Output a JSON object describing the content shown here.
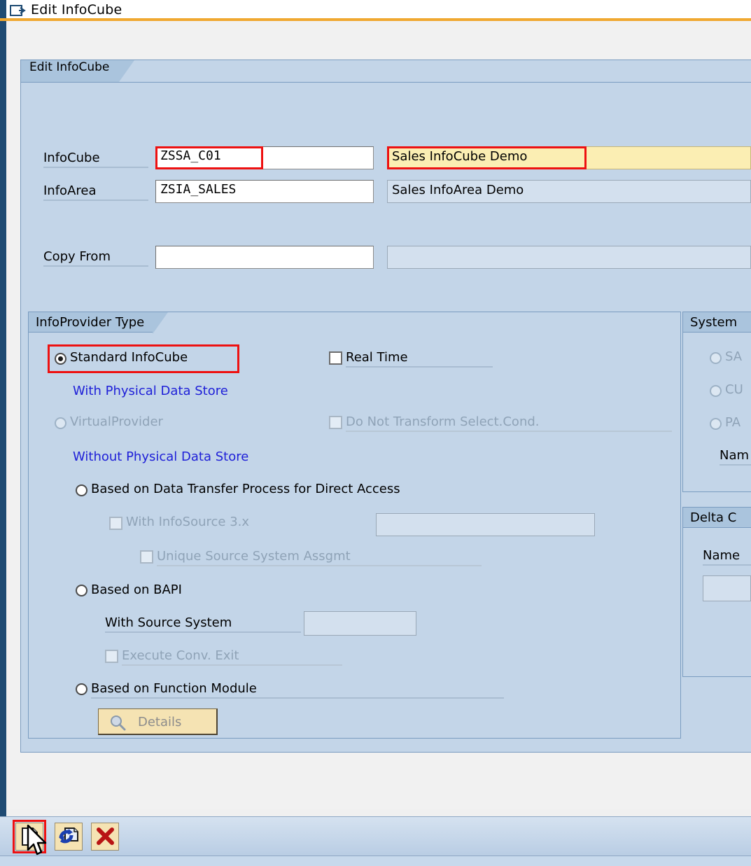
{
  "window": {
    "title": "Edit InfoCube",
    "title_icon": "edit-arrow-icon"
  },
  "main_tab": {
    "label": "Edit InfoCube"
  },
  "form": {
    "rows": [
      {
        "label": "InfoCube",
        "value": "ZSSA_C01",
        "description": "Sales InfoCube Demo",
        "highlighted": true,
        "description_highlighted": true
      },
      {
        "label": "InfoArea",
        "value": "ZSIA_SALES",
        "description": "Sales InfoArea Demo",
        "highlighted": false,
        "description_highlighted": false
      },
      {
        "label": "Copy From",
        "value": "",
        "description": "",
        "highlighted": false,
        "description_highlighted": false
      }
    ]
  },
  "infoprovider_type": {
    "group_label": "InfoProvider Type",
    "standard_infocube": {
      "label": "Standard InfoCube",
      "selected": true,
      "highlighted": true
    },
    "real_time": {
      "label": "Real Time",
      "checked": false
    },
    "with_physical_data_store": "With Physical Data Store",
    "virtual_provider": {
      "label": "VirtualProvider",
      "selected": false,
      "disabled": true
    },
    "do_not_transform": {
      "label": "Do Not Transform Select.Cond.",
      "checked": false,
      "disabled": true
    },
    "without_physical_data_store": "Without Physical Data Store",
    "based_on_dtp": {
      "label": "Based on Data Transfer Process for Direct Access",
      "selected": false
    },
    "with_infosource": {
      "label": "With InfoSource 3.x",
      "checked": false,
      "disabled": true,
      "value": ""
    },
    "unique_source_system": {
      "label": "Unique Source System Assgmt",
      "checked": false,
      "disabled": true
    },
    "based_on_bapi": {
      "label": "Based on BAPI",
      "selected": false
    },
    "with_source_system": {
      "label": "With Source System",
      "value": ""
    },
    "execute_conv_exit": {
      "label": "Execute Conv. Exit",
      "checked": false,
      "disabled": true
    },
    "based_on_function_module": {
      "label": "Based on Function Module",
      "selected": false
    },
    "details_button": {
      "label": "Details",
      "icon": "magnifier-icon",
      "disabled": true
    }
  },
  "system_panel": {
    "group_label": "System",
    "options": [
      {
        "label": "SA",
        "selected": false,
        "disabled": true
      },
      {
        "label": "CU",
        "selected": false,
        "disabled": true
      },
      {
        "label": "PA",
        "selected": false,
        "disabled": true
      }
    ],
    "name_label": "Nam"
  },
  "delta_cache_panel": {
    "group_label": "Delta C",
    "name_label": "Name",
    "name_value": ""
  },
  "toolbar": {
    "buttons": [
      {
        "name": "create-button",
        "icon": "document-new-icon",
        "highlighted": true
      },
      {
        "name": "activate-button",
        "icon": "refresh-activate-icon",
        "highlighted": false
      },
      {
        "name": "cancel-button",
        "icon": "red-x-icon",
        "highlighted": false
      }
    ]
  },
  "colors": {
    "highlight": "#ee1111",
    "panel": "#c3d5e8",
    "tab": "#aac4dd",
    "blue_text": "#1f20d8",
    "yellow_field": "#fbeeb3",
    "title_accent": "#f0a830"
  }
}
